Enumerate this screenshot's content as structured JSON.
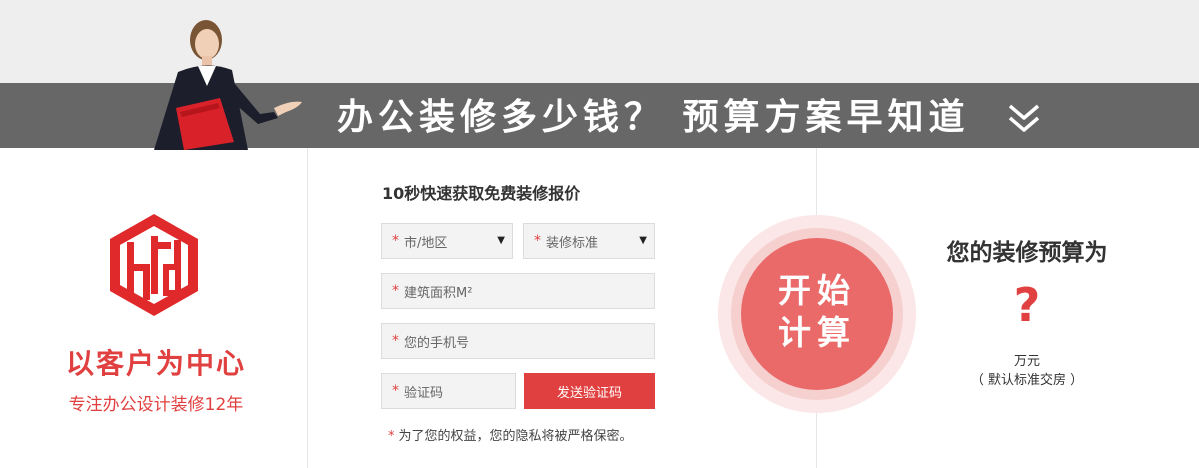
{
  "banner": {
    "title": "办公装修多少钱？ 预算方案早知道"
  },
  "brand": {
    "slogan": "以客户为中心",
    "subslogan": "专注办公设计装修12年"
  },
  "form": {
    "title": "10秒快速获取免费装修报价",
    "city_select": {
      "required_mark": "*",
      "value": "市/地区",
      "caret": "▼"
    },
    "standard_select": {
      "required_mark": "*",
      "value": "装修标准",
      "caret": "▼"
    },
    "area_input": {
      "required_mark": "*",
      "placeholder": "建筑面积M²"
    },
    "phone_input": {
      "required_mark": "*",
      "placeholder": "您的手机号"
    },
    "code_input": {
      "required_mark": "*",
      "placeholder": "验证码"
    },
    "send_code_label": "发送验证码",
    "privacy": {
      "mark": "*",
      "text": "为了您的权益，您的隐私将被严格保密。"
    }
  },
  "calculate": {
    "line1": "开始",
    "line2": "计算"
  },
  "result": {
    "title": "您的装修预算为",
    "value": "?",
    "unit": "万元",
    "note": "（ 默认标准交房 ）"
  },
  "colors": {
    "accent": "#e0403f",
    "banner_bg": "#686767",
    "top_bg": "#efeeee"
  },
  "icons": {
    "banner_arrow": "double-chevron-down-icon",
    "logo": "htd-logo-icon"
  }
}
